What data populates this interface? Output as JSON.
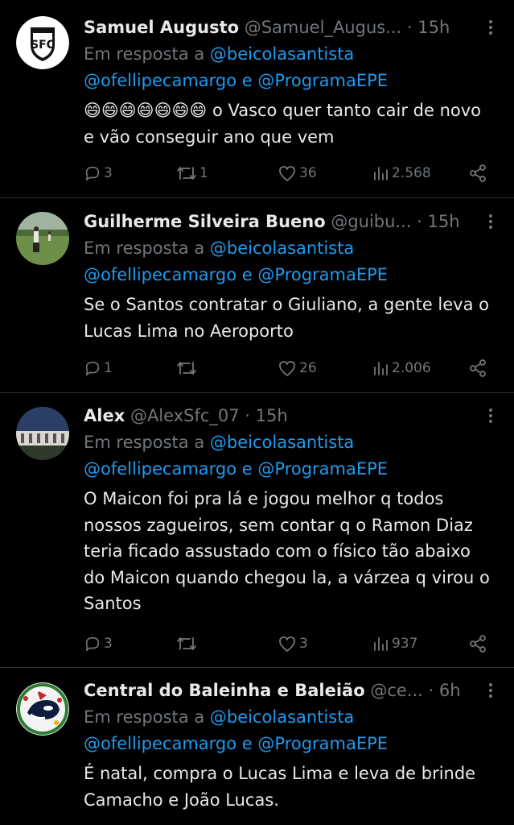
{
  "colors": {
    "background": "#000000",
    "text": "#e7e9ea",
    "muted": "#71767b",
    "link": "#1d9bf0",
    "divider": "#2f3336"
  },
  "tweets": [
    {
      "name": "Samuel Augusto",
      "handle": "@Samuel_Augus...",
      "dot": "·",
      "time": "15h",
      "reply_prefix": "Em resposta a",
      "mention1": "@beicolasantista",
      "mention2": "@ofellipecamargo",
      "conj": "e",
      "mention3": "@ProgramaEPE",
      "emojis": "😄😄😄😄😄😄😄",
      "text": "o Vasco quer tanto cair de novo e vão conseguir ano que vem",
      "replies": "3",
      "retweets": "1",
      "likes": "36",
      "views": "2.568",
      "avatar_icon": "santos-fc-crest-avatar"
    },
    {
      "name": "Guilherme Silveira Bueno",
      "handle": "@guibu...",
      "dot": "·",
      "time": "15h",
      "reply_prefix": "Em resposta a",
      "mention1": "@beicolasantista",
      "mention2": "@ofellipecamargo",
      "conj": "e",
      "mention3": "@ProgramaEPE",
      "text": "Se o Santos contratar o Giuliano, a gente leva o Lucas Lima no Aeroporto",
      "replies": "1",
      "retweets": "",
      "likes": "26",
      "views": "2.006",
      "avatar_icon": "football-field-photo-avatar"
    },
    {
      "name": "Alex",
      "handle": "@AlexSfc_07",
      "dot": "·",
      "time": "15h",
      "reply_prefix": "Em resposta a",
      "mention1": "@beicolasantista",
      "mention2": "@ofellipecamargo",
      "conj": "e",
      "mention3": "@ProgramaEPE",
      "text": "O Maicon foi pra lá e jogou melhor q todos nossos zagueiros, sem contar q o Ramon Diaz teria ficado assustado com o físico tão abaixo do Maicon quando chegou la, a várzea q virou o Santos",
      "replies": "3",
      "retweets": "",
      "likes": "3",
      "views": "937",
      "avatar_icon": "stadium-photo-avatar"
    },
    {
      "name": "Central do Baleinha e Baleião",
      "handle": "@ce...",
      "dot": "·",
      "time": "6h",
      "reply_prefix": "Em resposta a",
      "mention1": "@beicolasantista",
      "mention2": "@ofellipecamargo",
      "conj": "e",
      "mention3": "@ProgramaEPE",
      "text": "É natal, compra o Lucas Lima e leva de brinde Camacho e João Lucas.",
      "avatar_icon": "orca-christmas-avatar"
    }
  ]
}
